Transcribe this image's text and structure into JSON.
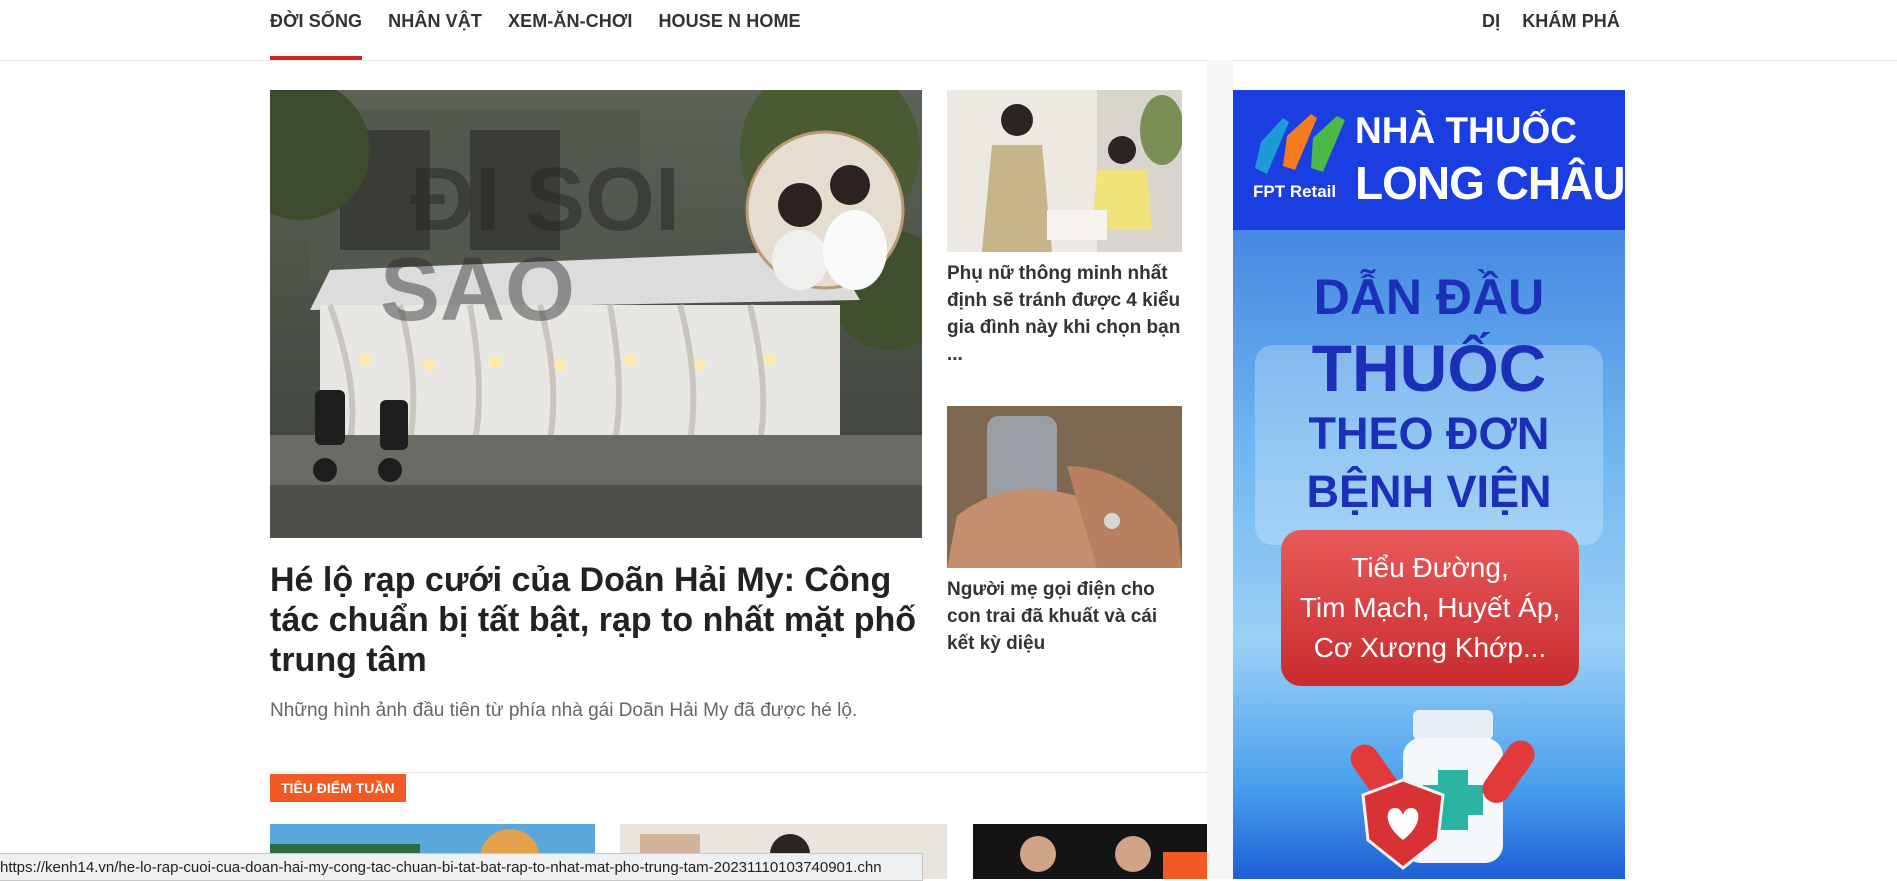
{
  "nav": {
    "left_items": [
      "ĐỜI SỐNG",
      "NHÂN VẬT",
      "XEM-ĂN-CHƠI",
      "HOUSE N HOME"
    ],
    "right_items": [
      "DỊ",
      "KHÁM PHÁ"
    ],
    "active_index": 0
  },
  "hero": {
    "title": "Hé lộ rạp cưới của Doãn Hải My: Công tác chuẩn bị tất bật, rạp to nhất mặt phố trung tâm",
    "sapo": "Những hình ảnh đầu tiên từ phía nhà gái Doãn Hải My đã được hé lộ.",
    "image_watermark": "ĐI SOI SAO",
    "image_alt": "Rạp cưới nhà Doãn Hải My"
  },
  "side_articles": [
    {
      "title": "Phụ nữ thông minh nhất định sẽ tránh được 4 kiểu gia đình này khi chọn bạn ..."
    },
    {
      "title": "Người mẹ gọi điện cho con trai đã khuất và cái kết kỳ diệu"
    }
  ],
  "section": {
    "tag": "TIÊU ĐIỂM TUẦN"
  },
  "ad": {
    "fpt_label": "FPT Retail",
    "brand_line1": "NHÀ THUỐC",
    "brand_line2": "LONG CHÂU",
    "headline1": "DẪN ĐẦU",
    "headline2": "THUỐC",
    "headline3": "THEO ĐƠN",
    "headline4": "BỆNH VIỆN",
    "conditions": [
      "Tiểu Đường,",
      "Tim Mạch, Huyết Áp,",
      "Cơ Xương Khớp..."
    ],
    "colors": {
      "header": "#1a3ee0",
      "headline": "#1b2fb8",
      "red": "#c92b2f"
    }
  },
  "status_url": "https://kenh14.vn/he-lo-rap-cuoi-cua-doan-hai-my-cong-tac-chuan-bi-tat-bat-rap-to-nhat-mat-pho-trung-tam-20231110103740901.chn",
  "colors": {
    "accent": "#d0202a",
    "tag": "#f15a22"
  }
}
